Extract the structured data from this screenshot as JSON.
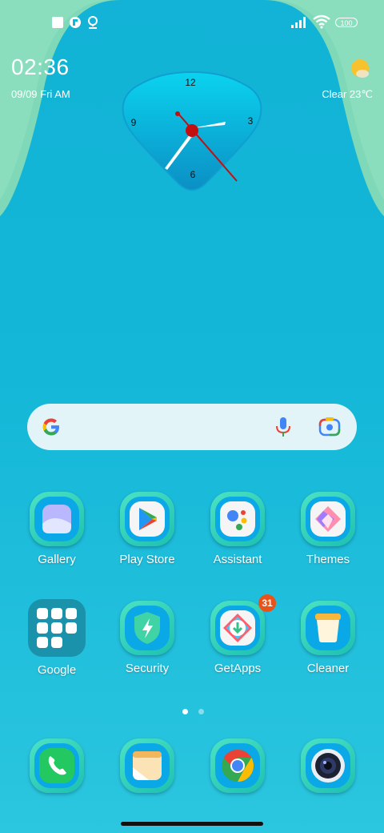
{
  "status_bar": {
    "battery_level": "100",
    "icons": [
      "app-notification-icon",
      "notification-icon",
      "location-icon",
      "signal-icon",
      "wifi-icon",
      "battery-icon"
    ]
  },
  "lockscreen_widget": {
    "time": "02:36",
    "date": "09/09 Fri AM",
    "weather": "Clear 23℃",
    "clock_numbers": {
      "twelve": "12",
      "three": "3",
      "six": "6",
      "nine": "9"
    }
  },
  "search": {
    "icons": [
      "google-logo-icon",
      "mic-icon",
      "lens-icon"
    ]
  },
  "apps_row1": [
    {
      "label": "Gallery",
      "icon": "gallery-icon"
    },
    {
      "label": "Play Store",
      "icon": "play-store-icon"
    },
    {
      "label": "Assistant",
      "icon": "assistant-icon"
    },
    {
      "label": "Themes",
      "icon": "themes-icon"
    }
  ],
  "apps_row2": [
    {
      "label": "Google",
      "icon": "folder-icon"
    },
    {
      "label": "Security",
      "icon": "security-icon"
    },
    {
      "label": "GetApps",
      "icon": "getapps-icon",
      "badge": "31"
    },
    {
      "label": "Cleaner",
      "icon": "cleaner-icon"
    }
  ],
  "dock": [
    {
      "icon": "phone-icon"
    },
    {
      "icon": "notes-icon"
    },
    {
      "icon": "chrome-icon"
    },
    {
      "icon": "camera-icon"
    }
  ],
  "page_indicator": {
    "pages": 2,
    "current": 1
  },
  "colors": {
    "accent": "#14b7d8",
    "badge": "#e8531a",
    "wave": "#7fd9b8"
  }
}
